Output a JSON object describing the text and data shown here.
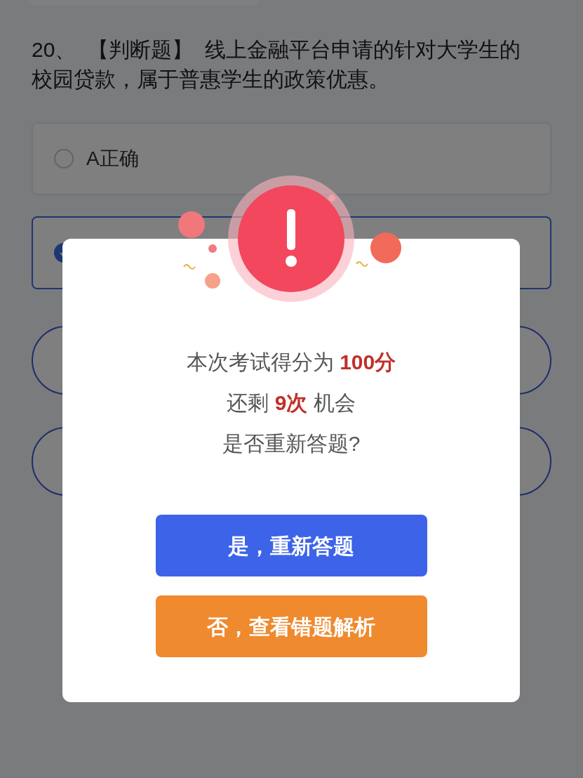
{
  "question": {
    "text": "20、  【判断题】  线上金融平台申请的针对大学生的校园贷款，属于普惠学生的政策优惠。"
  },
  "options": [
    {
      "label": "A正确",
      "selected": false
    },
    {
      "selected": true
    }
  ],
  "dialog": {
    "lines": [
      "本次考试得分为 **100分**",
      "还剩 **9次** 机会",
      "是否重新答题?"
    ],
    "buttons": [
      {
        "label": "是，重新答题",
        "kind": "primary"
      },
      {
        "label": "否，查看错题解析",
        "kind": "secondary"
      }
    ]
  }
}
